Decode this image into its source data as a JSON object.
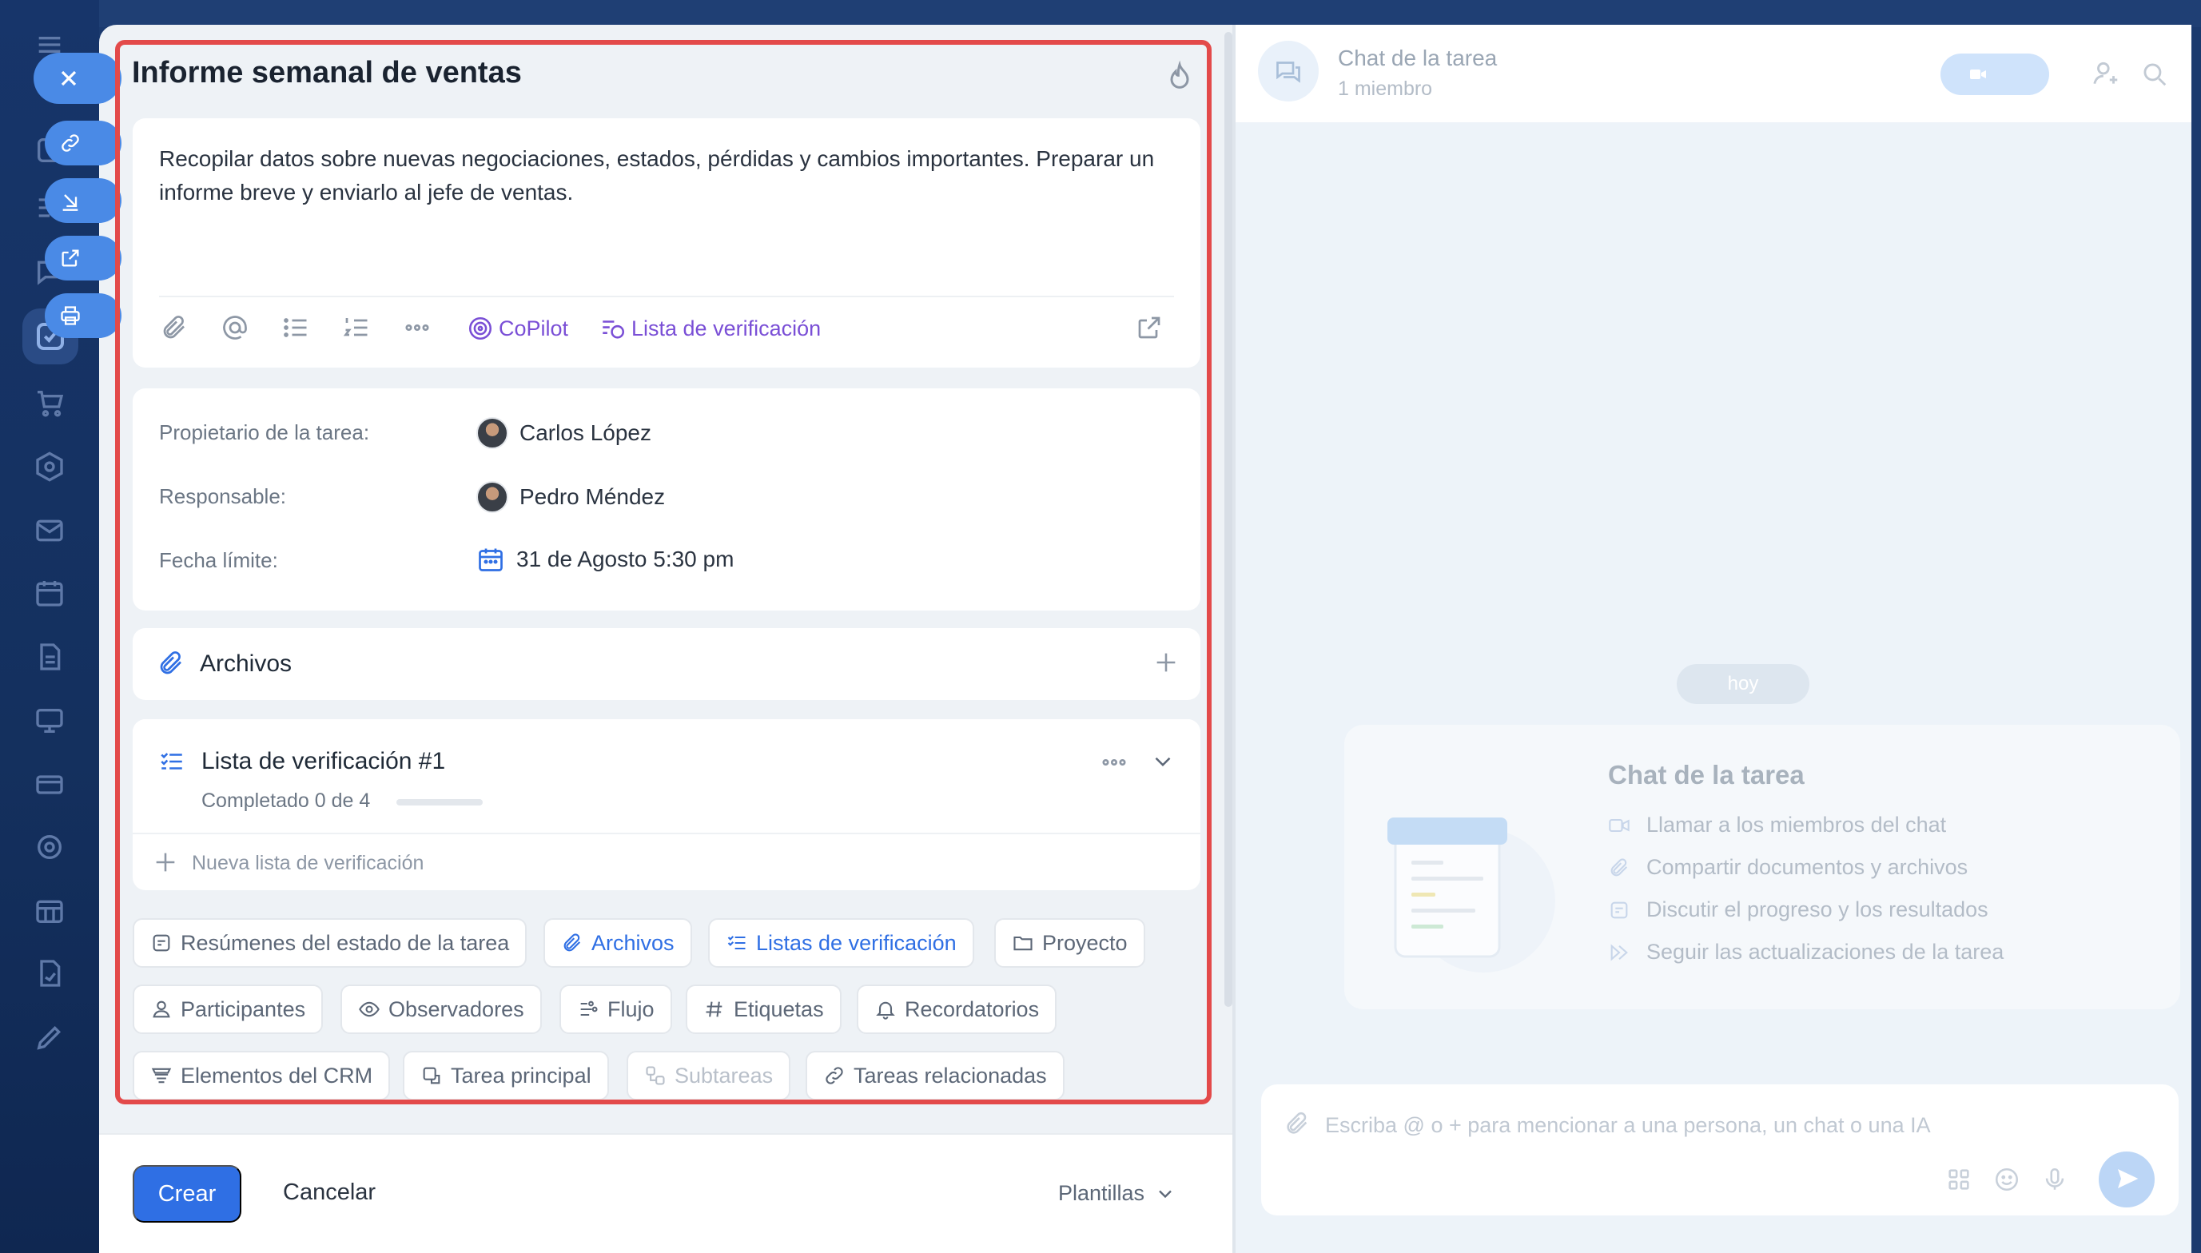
{
  "task": {
    "title": "Informe semanal de ventas",
    "description": "Recopilar datos sobre nuevas negociaciones, estados, pérdidas y cambios importantes. Preparar un informe breve y enviarlo al jefe de ventas.",
    "toolbar": {
      "copilot": "CoPilot",
      "checklist": "Lista de verificación"
    },
    "fields": {
      "owner_label": "Propietario de la tarea:",
      "owner_value": "Carlos López",
      "responsible_label": "Responsable:",
      "responsible_value": "Pedro Méndez",
      "deadline_label": "Fecha límite:",
      "deadline_value": "31 de Agosto 5:30 pm"
    },
    "files": {
      "title": "Archivos"
    },
    "checklist": {
      "title": "Lista de verificación #1",
      "status": "Completado 0 de 4",
      "completed": 0,
      "total": 4,
      "new": "Nueva lista de verificación"
    },
    "chips": {
      "summaries": "Resúmenes del estado de la tarea",
      "files": "Archivos",
      "checklists": "Listas de verificación",
      "project": "Proyecto",
      "participants": "Participantes",
      "observers": "Observadores",
      "flow": "Flujo",
      "tags": "Etiquetas",
      "reminders": "Recordatorios",
      "crm": "Elementos del CRM",
      "parent": "Tarea principal",
      "subtasks": "Subtareas",
      "related": "Tareas relacionadas"
    }
  },
  "footer": {
    "create": "Crear",
    "cancel": "Cancelar",
    "templates": "Plantillas"
  },
  "chat": {
    "title": "Chat de la tarea",
    "members": "1 miembro",
    "today": "hoy",
    "empty_title": "Chat de la tarea",
    "features": [
      "Llamar a los miembros del chat",
      "Compartir documentos y archivos",
      "Discutir el progreso y los resultados",
      "Seguir las actualizaciones de la tarea"
    ],
    "composer_placeholder": "Escriba @ o + para mencionar a una persona, un chat o una IA"
  },
  "colors": {
    "accent": "#2f6fe4",
    "highlight": "#e34a4a",
    "copilot": "#7a4fd6"
  }
}
